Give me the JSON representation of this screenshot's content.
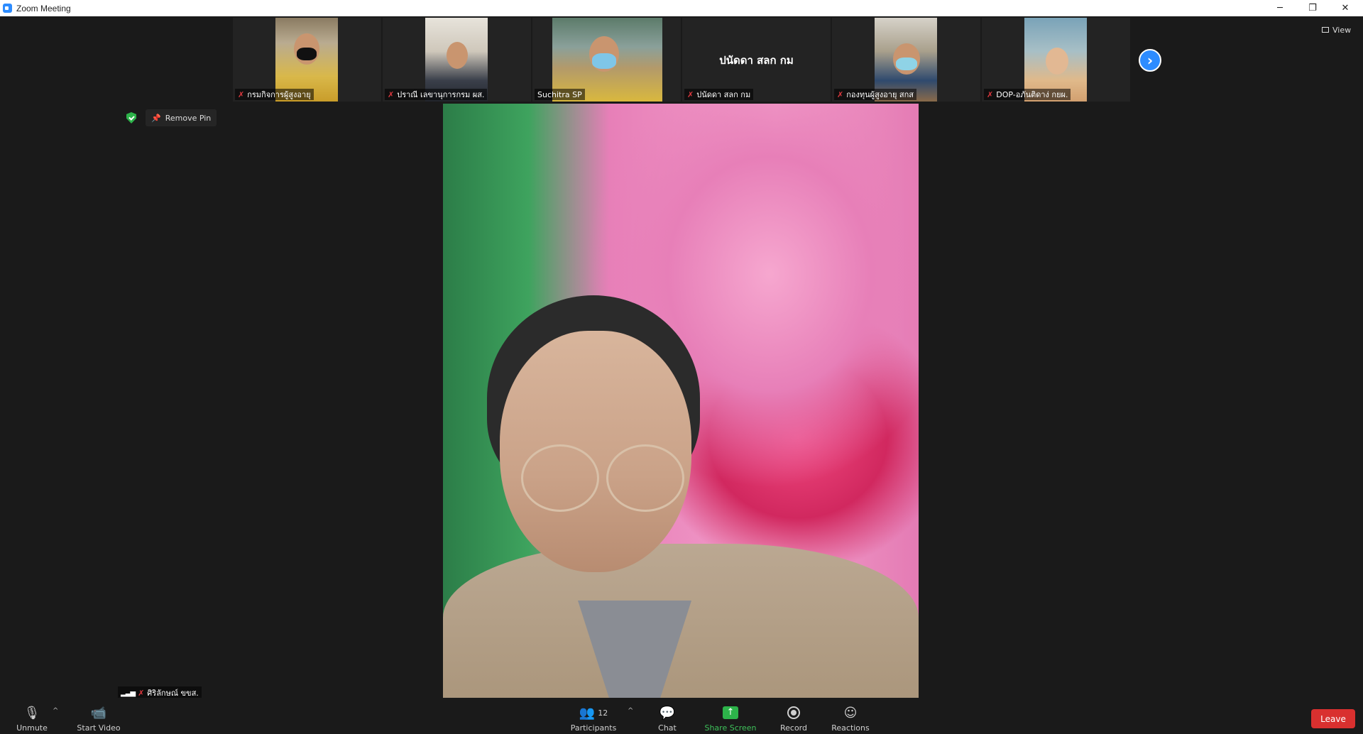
{
  "window": {
    "title": "Zoom Meeting",
    "minimize": "─",
    "maximize": "❐",
    "close": "✕"
  },
  "view_button": {
    "label": "View"
  },
  "remove_pin": {
    "label": "Remove Pin"
  },
  "thumbnails": [
    {
      "name": "กรมกิจการผู้สูงอายุ",
      "muted": true,
      "video": true
    },
    {
      "name": "ปราณี เลขานุการกรม ผส.",
      "muted": true,
      "video": true
    },
    {
      "name": "Suchitra SP",
      "muted": false,
      "video": true
    },
    {
      "name": "ปนัดดา สลก กม",
      "muted": true,
      "video": false,
      "center_name": "ปนัดดา สลก กม"
    },
    {
      "name": "กองทุนผู้สูงอายุ สกส",
      "muted": true,
      "video": true
    },
    {
      "name": "DOP-อภันติดาง่ กยผ.",
      "muted": true,
      "video": true
    }
  ],
  "self_view": {
    "name": "ศิริลักษณ์ ขขส.",
    "muted": true
  },
  "toolbar": {
    "unmute": "Unmute",
    "start_video": "Start Video",
    "participants": "Participants",
    "participants_count": "12",
    "chat": "Chat",
    "share_screen": "Share Screen",
    "record": "Record",
    "reactions": "Reactions",
    "leave": "Leave"
  },
  "icons": {
    "mic_off": "mic-off-icon",
    "video_off": "video-off-icon",
    "participants": "participants-icon",
    "chat": "chat-icon",
    "share": "share-screen-icon",
    "record": "record-icon",
    "reactions": "reactions-icon",
    "next": "chevron-right-icon",
    "security": "shield-icon",
    "pin": "pin-icon"
  },
  "colors": {
    "accent": "#2d8cff",
    "leave": "#d9302f",
    "share": "#2db34a",
    "muted_mic": "#e0383e",
    "background": "#1a1a1a"
  }
}
